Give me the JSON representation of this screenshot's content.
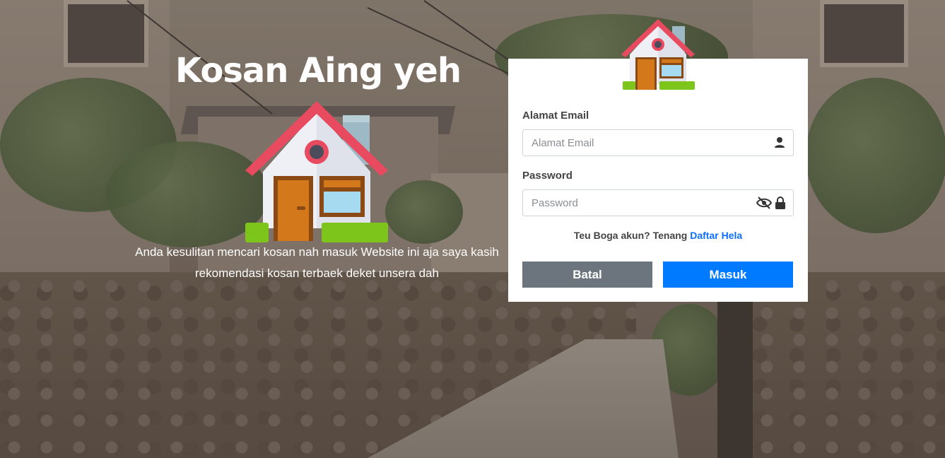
{
  "hero": {
    "title": "Kosan Aing yeh",
    "description": "Anda kesulitan mencari kosan nah masuk Website ini aja saya kasih rekomendasi kosan terbaek deket unsera dah"
  },
  "login": {
    "email_label": "Alamat Email",
    "email_placeholder": "Alamat Email",
    "email_value": "",
    "password_label": "Password",
    "password_placeholder": "Password",
    "password_value": "",
    "signup_prompt": "Teu Boga akun? Tenang",
    "signup_link": "Daftar Hela",
    "cancel_label": "Batal",
    "submit_label": "Masuk"
  },
  "icons": {
    "logo": "house-icon",
    "email_field": "user-icon",
    "password_toggle": "eye-slash-icon",
    "password_lock": "lock-icon"
  },
  "colors": {
    "primary": "#007bff",
    "secondary": "#6c757d",
    "link": "#0d6efd",
    "roof": "#e84a5f",
    "door": "#d4781c",
    "grass": "#7ec51b"
  }
}
